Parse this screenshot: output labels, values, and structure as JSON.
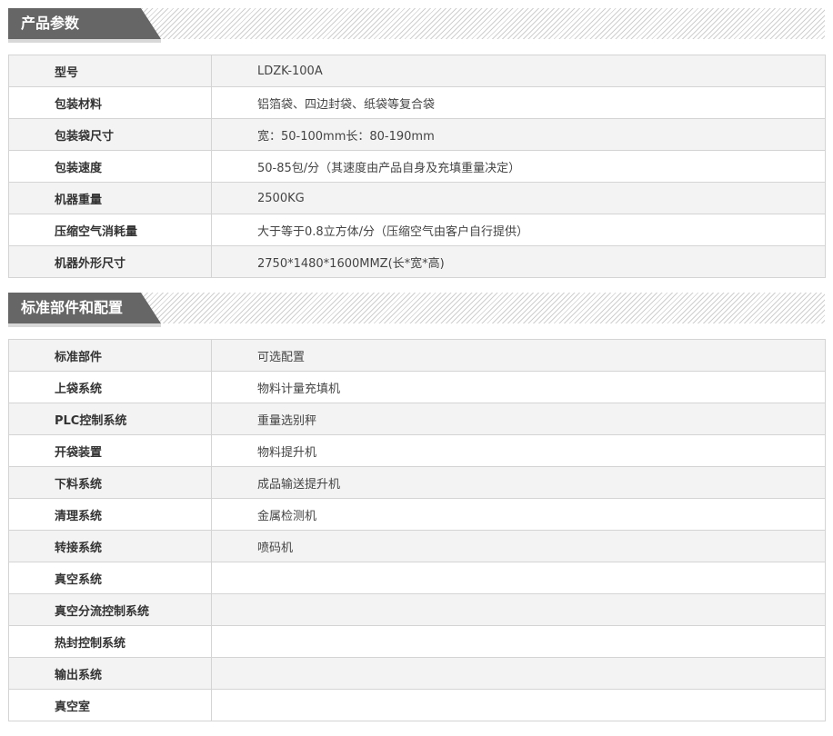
{
  "sections": [
    {
      "title": "产品参数",
      "rows": [
        {
          "label": "型号",
          "value": "LDZK-100A"
        },
        {
          "label": "包装材料",
          "value": "铝箔袋、四边封袋、纸袋等复合袋"
        },
        {
          "label": "包装袋尺寸",
          "value": "宽：50-100mm长：80-190mm"
        },
        {
          "label": "包装速度",
          "value": "50-85包/分（其速度由产品自身及充填重量决定）"
        },
        {
          "label": "机器重量",
          "value": "2500KG"
        },
        {
          "label": "压缩空气消耗量",
          "value": "大于等于0.8立方体/分（压缩空气由客户自行提供）"
        },
        {
          "label": "机器外形尺寸",
          "value": "2750*1480*1600MMZ(长*宽*高)"
        }
      ]
    },
    {
      "title": "标准部件和配置",
      "rows": [
        {
          "label": "标准部件",
          "value": "可选配置"
        },
        {
          "label": "上袋系统",
          "value": "物料计量充填机"
        },
        {
          "label": "PLC控制系统",
          "value": "重量选别秤"
        },
        {
          "label": "开袋装置",
          "value": "物料提升机"
        },
        {
          "label": "下料系统",
          "value": "成品输送提升机"
        },
        {
          "label": "清理系统",
          "value": "金属检测机"
        },
        {
          "label": "转接系统",
          "value": "喷码机"
        },
        {
          "label": "真空系统",
          "value": ""
        },
        {
          "label": "真空分流控制系统",
          "value": ""
        },
        {
          "label": "热封控制系统",
          "value": ""
        },
        {
          "label": "输出系统",
          "value": ""
        },
        {
          "label": "真空室",
          "value": ""
        }
      ]
    }
  ]
}
